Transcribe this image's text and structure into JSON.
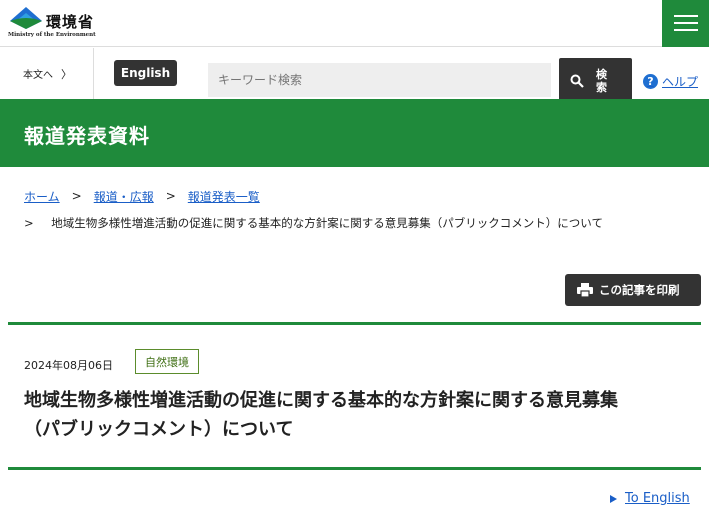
{
  "header": {
    "logo_name": "環境省",
    "logo_sub": "Ministry of the Environment",
    "menu_icon": "hamburger-icon"
  },
  "utility": {
    "skip_label": "本文へ",
    "english_label": "English",
    "search_placeholder": "キーワード検索",
    "search_button": "検索",
    "help_label": "ヘルプ",
    "help_glyph": "?"
  },
  "page": {
    "title": "報道発表資料"
  },
  "breadcrumb": {
    "items": [
      "ホーム",
      "報道・広報",
      "報道発表一覧"
    ],
    "separator": ">",
    "current": "地域生物多様性増進活動の促進に関する基本的な方針案に関する意見募集（パブリックコメント）について"
  },
  "toolbar": {
    "print_label": "この記事を印刷"
  },
  "article": {
    "date": "2024年08月06日",
    "tag": "自然環境",
    "title_line1": "地域生物多様性増進活動の促進に関する基本的な方針案に関する意見募集",
    "title_line2": "（パブリックコメント）について"
  },
  "footer_link": {
    "to_english": "To English"
  },
  "colors": {
    "brand_green": "#1f8a3b",
    "link_blue": "#1a5ec7",
    "dark_button": "#333333"
  }
}
